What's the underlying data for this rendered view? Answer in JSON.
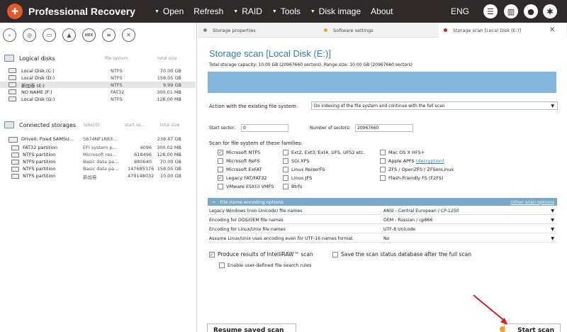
{
  "app": {
    "title": "Professional Recovery",
    "menu": [
      "Open",
      "Refresh",
      "RAID",
      "Tools",
      "Disk image",
      "About"
    ],
    "lang": "ENG",
    "icons": [
      "chat-icon",
      "book-icon",
      "user-icon",
      "gear-icon"
    ]
  },
  "toolbar": {
    "hex_label": "HEX"
  },
  "logical": {
    "title": "Logical disks",
    "col_fs": "file system",
    "col_size": "total size",
    "disks": [
      {
        "name": "Local Disk (C:)",
        "fs": "NTFS",
        "size": "70.00 GB"
      },
      {
        "name": "Local Disk (D:)",
        "fs": "NTFS",
        "size": "158.05 GB"
      },
      {
        "name": "新加卷 (E:)",
        "fs": "NTFS",
        "size": "9.99 GB"
      },
      {
        "name": "NO NAME (F:)",
        "fs": "FAT32",
        "size": "300.01 MB"
      },
      {
        "name": "Local Disk (G:)",
        "fs": "NTFS",
        "size": "128.00 MB"
      }
    ]
  },
  "storages": {
    "title": "Connected storages",
    "col_label": "label/ID",
    "col_start": "start se...",
    "col_size": "total size",
    "drive": {
      "name": "Drive0: Fixed SAMSU...",
      "label": "S674NF1R83...",
      "size": "238.47 GB"
    },
    "partitions": [
      {
        "name": "FAT32 partition",
        "label": "EFI system p...",
        "start": "4096",
        "size": "300.02 MB"
      },
      {
        "name": "NTFS partition",
        "label": "Microsoft res...",
        "start": "618496",
        "size": "128.00 MB"
      },
      {
        "name": "NTFS partition",
        "label": "Basic data pa...",
        "start": "880640",
        "size": "70.00 GB"
      },
      {
        "name": "NTFS partition",
        "label": "Basic data pa...",
        "start": "147685376",
        "size": "158.05 GB"
      },
      {
        "name": "NTFS partition",
        "label": "新加卷",
        "start": "479148032",
        "size": "10.00 GB"
      }
    ]
  },
  "tabs": [
    {
      "label": "Storage properties",
      "color": "#888888"
    },
    {
      "label": "Software settings",
      "color": "#e8a21a"
    },
    {
      "label": "Storage scan [Local Disk (E:)]",
      "color": "#cc2222"
    }
  ],
  "scan": {
    "title": "Storage scan [Local Disk (E:)]",
    "capacity": "Total storage capacity: 10.00 GB (20967660 sectors). Range size: 10.00 GB (20967660 sectors)",
    "action_label": "Action with the existing file system:",
    "action_value": "Do indexing of the file system and continue with the full scan",
    "start_sector_label": "Start sector:",
    "start_sector_value": "0",
    "num_sectors_label": "Number of sectors:",
    "num_sectors_value": "20967660",
    "families_label": "Scan for file system of these families:",
    "families": [
      {
        "label": "Microsoft NTFS",
        "checked": true
      },
      {
        "label": "Microsoft ReFS",
        "checked": false
      },
      {
        "label": "Microsoft ExFAT",
        "checked": false
      },
      {
        "label": "Legacy FAT/FAT32",
        "checked": true
      },
      {
        "label": "VMware ESX(i) VMFS",
        "checked": false
      },
      {
        "label": "Ext2, Ext3, Ext4, UFS, UFS2 etc.",
        "checked": false
      },
      {
        "label": "SGI XFS",
        "checked": false
      },
      {
        "label": "Linux ReiserFS",
        "checked": false
      },
      {
        "label": "Linux JFS",
        "checked": false
      },
      {
        "label": "Btrfs",
        "checked": false
      },
      {
        "label": "Mac OS X HFS+",
        "checked": false
      },
      {
        "label": "Apple APFS",
        "checked": false,
        "link": "(decryption)"
      },
      {
        "label": "ZFS / OpenZFS / ZFSonLinux",
        "checked": false
      },
      {
        "label": "Flash-Friendly FS (F2FS)",
        "checked": false
      }
    ],
    "encoding_title": "File name encoding options",
    "other_options": "Other scan options",
    "encodings": [
      {
        "key": "Legacy Windows (non-Unicode) file names",
        "value": "ANSI - Central European / CP-1250"
      },
      {
        "key": "Encoding for DOS/OEM file names",
        "value": "OEM - Russian / cp866"
      },
      {
        "key": "Encoding for Linux/Unix file names",
        "value": "UTF-8 Unicode"
      },
      {
        "key": "Assume Linux/Unix uses encoding even for UTF-16 names format",
        "value": "No"
      }
    ],
    "intelliraw": "Produce results of IntelliRAW™ scan",
    "save_db": "Save the scan status database after the full scan",
    "user_rules": "Enable user-defined file search rules",
    "resume_button": "Resume saved scan",
    "start_button": "Start scan"
  }
}
